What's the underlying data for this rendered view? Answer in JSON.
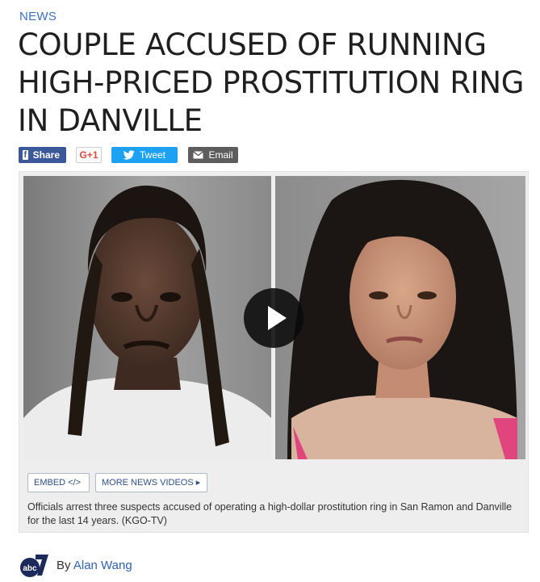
{
  "section": "NEWS",
  "headline": "COUPLE ACCUSED OF RUNNING HIGH-PRICED PROSTITUTION RING IN DANVILLE",
  "share": {
    "facebook_label": "Share",
    "facebook_glyph": "f",
    "googleplus_label": "G+1",
    "twitter_label": "Tweet",
    "email_label": "Email"
  },
  "video": {
    "embed_label": "EMBED </>",
    "more_label": "MORE NEWS VIDEOS ▸",
    "caption": "Officials arrest three suspects accused of operating a high-dollar prostitution ring in San Ramon and Danville for the last 14 years. (KGO-TV)"
  },
  "byline": {
    "prefix": "By ",
    "author": "Alan Wang",
    "logo_icon": "abc7-logo-icon"
  },
  "colors": {
    "section": "#3a6fc4",
    "facebook": "#3b5998",
    "twitter": "#1da1f2",
    "email": "#5d5d5d",
    "author_link": "#2e62b4"
  }
}
